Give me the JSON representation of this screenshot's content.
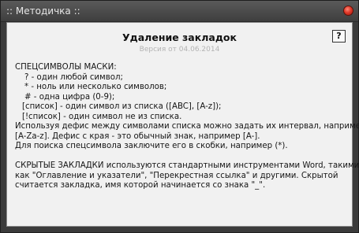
{
  "window": {
    "title": ":: Методичка ::"
  },
  "panel": {
    "heading": "Удаление закладок",
    "version": "Версия от 04.06.2014",
    "help_label": "?"
  },
  "content": {
    "lines": [
      "СПЕЦСИМВОЛЫ МАСКИ:",
      "? - один любой символ;",
      "* - ноль или несколько символов;",
      "# - одна цифра (0-9);",
      "[список] - один символ из списка ([ABC], [A-z]);",
      "[!список] - один символ не из списка.",
      "Используя дефис между символами списка можно задать их интервал, например",
      "[A-Za-z]. Дефис с края - это обычный знак, например [A-].",
      "Для поиска спецсимвола заключите его в скобки, например (*).",
      "СКРЫТЫЕ ЗАКЛАДКИ используются стандартными инструментами Word, такими",
      "как \"Оглавление и указатели\", \"Перекрестная ссылка\" и другими. Скрытой",
      "считается закладка, имя которой начинается со знака \"_\"."
    ]
  }
}
